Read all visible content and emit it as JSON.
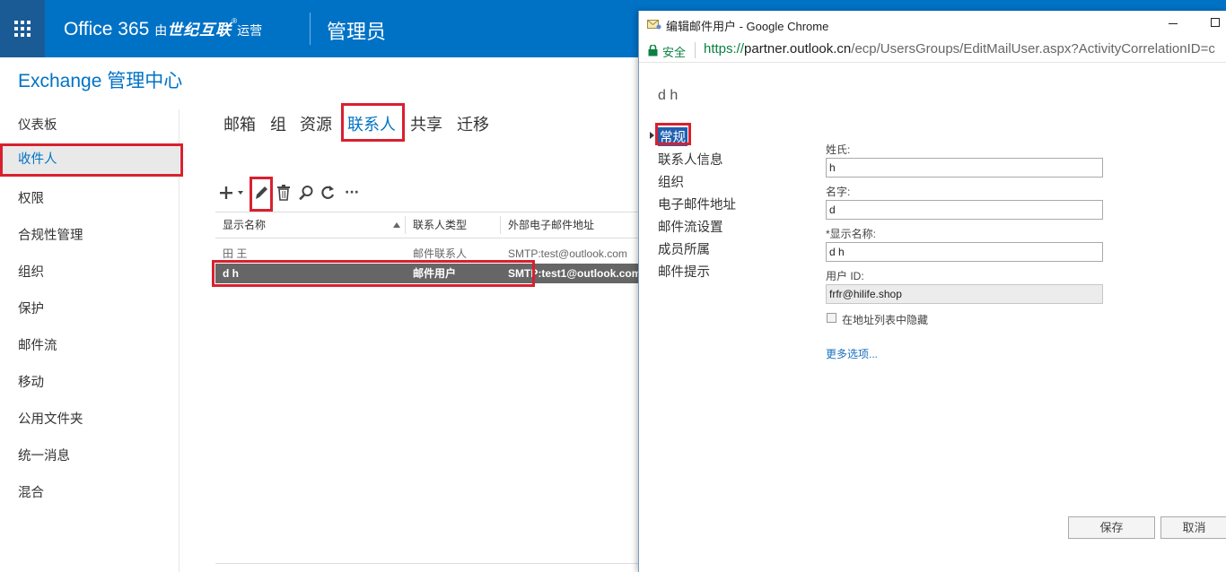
{
  "header": {
    "brand_main": "Office 365",
    "brand_prefix": "由",
    "brand_bold": "世纪互联",
    "brand_reg": "®",
    "brand_suffix": "运营",
    "section_title": "管理员"
  },
  "app_title": "Exchange 管理中心",
  "leftnav": {
    "items": [
      {
        "label": "仪表板"
      },
      {
        "label": "收件人",
        "active": true
      },
      {
        "label": "权限"
      },
      {
        "label": "合规性管理"
      },
      {
        "label": "组织"
      },
      {
        "label": "保护"
      },
      {
        "label": "邮件流"
      },
      {
        "label": "移动"
      },
      {
        "label": "公用文件夹"
      },
      {
        "label": "统一消息"
      },
      {
        "label": "混合"
      }
    ]
  },
  "subtabs": {
    "items": [
      {
        "label": "邮箱"
      },
      {
        "label": "组"
      },
      {
        "label": "资源"
      },
      {
        "label": "联系人",
        "active": true
      },
      {
        "label": "共享"
      },
      {
        "label": "迁移"
      }
    ]
  },
  "toolbar": {
    "add_icon": "plus-icon",
    "edit_icon": "pencil-icon",
    "delete_icon": "trash-icon",
    "search_icon": "search-icon",
    "refresh_icon": "refresh-icon",
    "more_icon": "ellipsis-icon",
    "more_label": "···"
  },
  "table": {
    "headers": [
      "显示名称",
      "联系人类型",
      "外部电子邮件地址"
    ],
    "rows": [
      {
        "name": "田 王",
        "type": "邮件联系人",
        "email": "SMTP:test@outlook.com",
        "selected": false
      },
      {
        "name": "d h",
        "type": "邮件用户",
        "email": "SMTP:test1@outlook.com",
        "selected": true
      }
    ]
  },
  "popup": {
    "window_title": "编辑邮件用户 - Google Chrome",
    "secure_label": "安全",
    "url_scheme": "https://",
    "url_host": "partner.outlook.cn",
    "url_path": "/ecp/UsersGroups/EditMailUser.aspx?ActivityCorrelationID=c",
    "heading": "d h",
    "nav": [
      {
        "label": "常规",
        "active": true
      },
      {
        "label": "联系人信息"
      },
      {
        "label": "组织"
      },
      {
        "label": "电子邮件地址"
      },
      {
        "label": "邮件流设置"
      },
      {
        "label": "成员所属"
      },
      {
        "label": "邮件提示"
      }
    ],
    "fields": {
      "last_name_label": "姓氏:",
      "last_name_value": "h",
      "first_name_label": "名字:",
      "first_name_value": "d",
      "display_name_label": "*显示名称:",
      "display_name_value": "d h",
      "user_id_label": "用户 ID:",
      "user_id_value": "frfr@hilife.shop"
    },
    "hide_checkbox_label": "在地址列表中隐藏",
    "hide_checked": false,
    "more_options": "更多选项...",
    "save_label": "保存",
    "cancel_label": "取消"
  },
  "colors": {
    "brand_blue": "#0072c6",
    "highlight_red": "#d9202f",
    "selected_row": "#666666"
  }
}
